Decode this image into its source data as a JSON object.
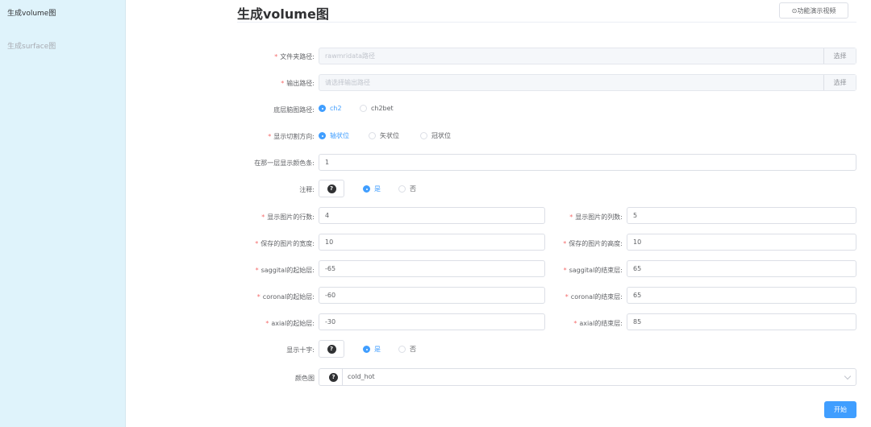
{
  "sidebar": {
    "items": [
      {
        "label": "生成volume图"
      },
      {
        "label": "生成surface图"
      }
    ]
  },
  "header": {
    "title": "生成volume图",
    "demo_label": "⊙功能演示视频"
  },
  "form": {
    "folder_path": {
      "label": "文件夹路径:",
      "placeholder": "rawmridata路径",
      "button": "选择"
    },
    "output_path": {
      "label": "输出路径:",
      "placeholder": "请选择输出路径",
      "button": "选择"
    },
    "base_brain": {
      "label": "底层脑图路径:",
      "options": [
        "ch2",
        "ch2bet"
      ],
      "selected": "ch2"
    },
    "slice_direction": {
      "label": "显示切割方向:",
      "options": [
        "轴状位",
        "矢状位",
        "冠状位"
      ],
      "selected": "轴状位"
    },
    "colorbar_layer": {
      "label": "在那一层显示颜色条:",
      "value": "1"
    },
    "annotation": {
      "label": "注释:",
      "options": [
        "是",
        "否"
      ],
      "selected": "是"
    },
    "rows": {
      "label": "显示图片的行数:",
      "value": "4"
    },
    "cols": {
      "label": "显示图片的列数:",
      "value": "5"
    },
    "img_width": {
      "label": "保存的图片的宽度:",
      "value": "10"
    },
    "img_height": {
      "label": "保存的图片的高度:",
      "value": "10"
    },
    "sagittal_start": {
      "label": "saggital的起始层:",
      "value": "-65"
    },
    "sagittal_end": {
      "label": "saggital的结束层:",
      "value": "65"
    },
    "coronal_start": {
      "label": "coronal的起始层:",
      "value": "-60"
    },
    "coronal_end": {
      "label": "coronal的结束层:",
      "value": "65"
    },
    "axial_start": {
      "label": "axial的起始层:",
      "value": "-30"
    },
    "axial_end": {
      "label": "axial的结束层:",
      "value": "85"
    },
    "crosshair": {
      "label": "显示十字:",
      "options": [
        "是",
        "否"
      ],
      "selected": "是"
    },
    "colormap": {
      "label": "颜色图",
      "value": "cold_hot"
    },
    "start_button": "开始"
  },
  "colors": {
    "accent": "#409eff",
    "required": "#f56c6c",
    "sidebar_bg": "#dff3fb"
  }
}
